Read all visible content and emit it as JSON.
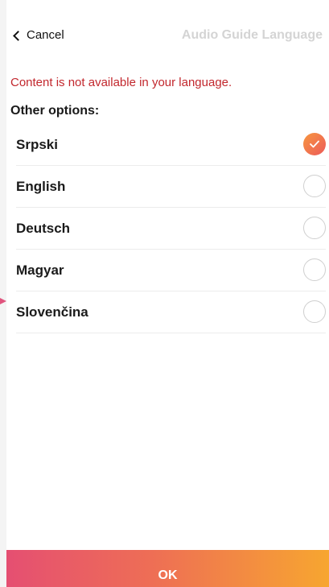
{
  "header": {
    "cancel_label": "Cancel",
    "title": "Audio Guide Language"
  },
  "notice": "Content is not available in your language.",
  "subheading": "Other options:",
  "languages": [
    {
      "label": "Srpski",
      "selected": true
    },
    {
      "label": "English",
      "selected": false
    },
    {
      "label": "Deutsch",
      "selected": false
    },
    {
      "label": "Magyar",
      "selected": false
    },
    {
      "label": "Slovenčina",
      "selected": false
    }
  ],
  "footer": {
    "ok_label": "OK"
  },
  "colors": {
    "notice_red": "#c2272d",
    "accent_orange": "#f7963f",
    "accent_pink": "#e54f72",
    "title_gray": "#d4d4d4"
  },
  "icons": {
    "back": "chevron-left-icon",
    "selected": "checkmark-icon"
  }
}
